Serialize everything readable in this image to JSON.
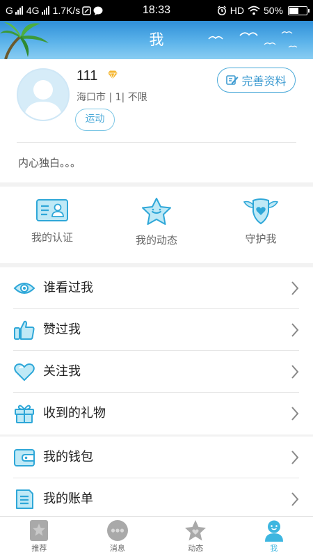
{
  "status_bar": {
    "carrier1": "G",
    "carrier2": "4G",
    "speed": "1.7K/s",
    "time": "18:33",
    "hd": "HD",
    "battery": "50%",
    "battery_level": 0.5
  },
  "header": {
    "title": "我"
  },
  "profile": {
    "username": "111",
    "location": "海口市 | 1| 不限",
    "tag": "运动",
    "edit_label": "完善资料",
    "signature": "内心独白。。。"
  },
  "quick_actions": [
    {
      "label": "我的认证",
      "icon": "id-card-icon"
    },
    {
      "label": "我的动态",
      "icon": "star-bubble-icon"
    },
    {
      "label": "守护我",
      "icon": "winged-shield-icon"
    }
  ],
  "menu_group1": [
    {
      "label": "谁看过我",
      "icon": "eye-icon"
    },
    {
      "label": "赞过我",
      "icon": "thumbs-up-icon"
    },
    {
      "label": "关注我",
      "icon": "heart-icon"
    },
    {
      "label": "收到的礼物",
      "icon": "gift-icon"
    }
  ],
  "menu_group2": [
    {
      "label": "我的钱包",
      "icon": "wallet-icon"
    },
    {
      "label": "我的账单",
      "icon": "bill-icon"
    }
  ],
  "bottom_nav": [
    {
      "label": "推荐",
      "icon": "recommend-icon",
      "active": false
    },
    {
      "label": "消息",
      "icon": "message-icon",
      "active": false
    },
    {
      "label": "动态",
      "icon": "moments-icon",
      "active": false
    },
    {
      "label": "我",
      "icon": "me-icon",
      "active": true
    }
  ],
  "colors": {
    "accent": "#3db6e0",
    "header_top": "#2f8fd8",
    "background": "#f2f2f2"
  }
}
